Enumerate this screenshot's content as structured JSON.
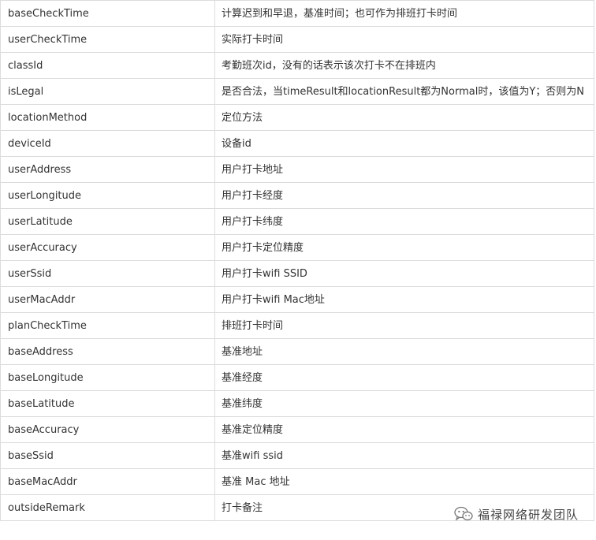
{
  "table": {
    "rows": [
      {
        "field": "baseCheckTime",
        "desc": "计算迟到和早退，基准时间；也可作为排班打卡时间"
      },
      {
        "field": "userCheckTime",
        "desc": "实际打卡时间"
      },
      {
        "field": "classId",
        "desc": "考勤班次id，没有的话表示该次打卡不在排班内"
      },
      {
        "field": "isLegal",
        "desc": "是否合法，当timeResult和locationResult都为Normal时，该值为Y；否则为N"
      },
      {
        "field": "locationMethod",
        "desc": "定位方法"
      },
      {
        "field": "deviceId",
        "desc": "设备id"
      },
      {
        "field": "userAddress",
        "desc": "用户打卡地址"
      },
      {
        "field": "userLongitude",
        "desc": "用户打卡经度"
      },
      {
        "field": "userLatitude",
        "desc": "用户打卡纬度"
      },
      {
        "field": "userAccuracy",
        "desc": "用户打卡定位精度"
      },
      {
        "field": "userSsid",
        "desc": "用户打卡wifi SSID"
      },
      {
        "field": "userMacAddr",
        "desc": "用户打卡wifi Mac地址"
      },
      {
        "field": "planCheckTime",
        "desc": "排班打卡时间"
      },
      {
        "field": "baseAddress",
        "desc": "基准地址"
      },
      {
        "field": "baseLongitude",
        "desc": "基准经度"
      },
      {
        "field": "baseLatitude",
        "desc": "基准纬度"
      },
      {
        "field": "baseAccuracy",
        "desc": "基准定位精度"
      },
      {
        "field": "baseSsid",
        "desc": "基准wifi ssid"
      },
      {
        "field": "baseMacAddr",
        "desc": "基准 Mac 地址"
      },
      {
        "field": "outsideRemark",
        "desc": "打卡备注"
      }
    ]
  },
  "watermark": {
    "text": "福禄网络研发团队",
    "icon": "wechat-icon"
  },
  "colors": {
    "border": "#dcdcdc",
    "text": "#333333"
  }
}
